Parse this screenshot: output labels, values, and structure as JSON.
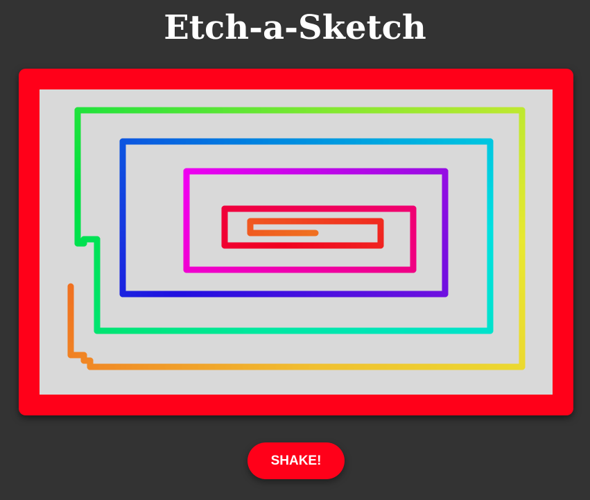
{
  "title": "Etch-a-Sketch",
  "shake_button": {
    "label": "SHAKE!"
  },
  "colors": {
    "background": "#333333",
    "frame": "#ff0019",
    "screen": "#d9d9d9",
    "button": "#ff0019",
    "title_text": "#ffffff"
  },
  "drawing": {
    "path_colors": [
      "#f07020",
      "#f0c030",
      "#e8e830",
      "#80e830",
      "#00e040",
      "#00e8a0",
      "#00e0e0",
      "#0080e0",
      "#2010e0",
      "#8010e0",
      "#f000f0",
      "#f00080",
      "#f00020",
      "#f07020"
    ]
  }
}
